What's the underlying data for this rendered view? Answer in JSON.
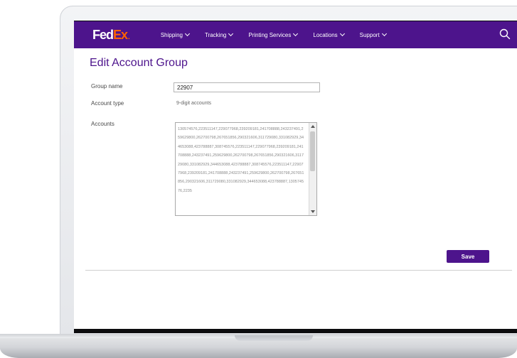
{
  "nav": {
    "logo_fed": "Fed",
    "logo_ex": "Ex",
    "logo_dot": ".",
    "items": [
      {
        "label": "Shipping"
      },
      {
        "label": "Tracking"
      },
      {
        "label": "Printing Services"
      },
      {
        "label": "Locations"
      },
      {
        "label": "Support"
      }
    ],
    "search_icon": "search-icon"
  },
  "page": {
    "title": "Edit Account Group"
  },
  "form": {
    "group_name_label": "Group name",
    "group_name_value": "22907",
    "account_type_label": "Account type",
    "account_type_value": "9-digit accounts",
    "accounts_label": "Accounts",
    "accounts_value": "130574576,223511147,229077968,239209181,241708888,243237491,259629800,262700798,267651856,290321606,311729080,331082929,344653088,423788887,308745576,223511147,229077968,239209181,241708888,243237491,259629800,262700798,267651856,290321606,311729080,331082929,344653088,423788887,308745576,223511147,229077968,239209181,241708888,243237491,259629800,262700798,267651856,290321606,311729080,331082929,344653088,423788887,130574576,2235",
    "save_label": "Save"
  },
  "colors": {
    "brand_purple": "#4d148c",
    "brand_orange": "#ff6200"
  }
}
